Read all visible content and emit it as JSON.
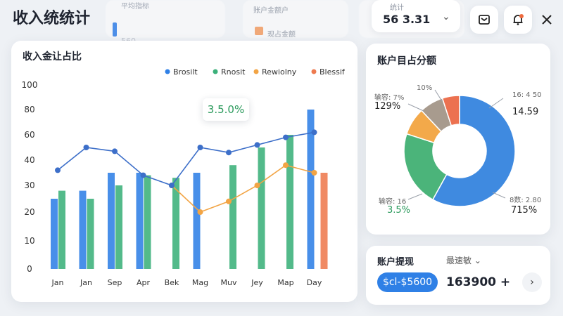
{
  "header": {
    "title": "收入统统计",
    "bg_items": [
      "平均指标",
      "账户金额户",
      "现占金额"
    ],
    "bg_value": "560",
    "period_label": "统计",
    "period_value": "56 3.31"
  },
  "icons": {
    "export": "export-icon",
    "alert": "bell-icon",
    "close": "close-icon"
  },
  "colors": {
    "blue": "#2f80e6",
    "green": "#3bb07a",
    "orange": "#f2a444",
    "red": "#ee7a4f",
    "accent": "#2f80e6"
  },
  "income_card": {
    "title": "收入金让占比",
    "legend": [
      "Brosilt",
      "Rnosit",
      "Rewiolny",
      "Blessif"
    ],
    "tooltip": "3.5.0%"
  },
  "chart_data": {
    "type": "bar",
    "title": "收入金让占比",
    "categories": [
      "Jan",
      "Jan",
      "Sep",
      "Apr",
      "Bek",
      "Mag",
      "Muv",
      "Jey",
      "Map",
      "Day"
    ],
    "yticks": [
      0,
      10,
      20,
      30,
      40,
      60,
      80,
      100
    ],
    "series": [
      {
        "name": "Brosilt",
        "kind": "bar",
        "values": [
          25,
          28,
          35,
          35,
          0,
          35,
          0,
          0,
          0,
          80
        ]
      },
      {
        "name": "Rnosit",
        "kind": "bar",
        "values": [
          28,
          25,
          30,
          34,
          33,
          0,
          38,
          50,
          60,
          0
        ]
      },
      {
        "name": "Rewiolny",
        "kind": "line",
        "values": [
          null,
          null,
          null,
          null,
          30,
          20,
          24,
          30,
          38,
          35
        ]
      },
      {
        "name": "Blessif",
        "kind": "bar",
        "values": [
          0,
          0,
          0,
          0,
          0,
          0,
          0,
          0,
          0,
          35
        ]
      },
      {
        "name": "Brosilt",
        "kind": "line",
        "values": [
          36,
          50,
          47,
          34,
          30,
          50,
          46,
          52,
          58,
          62
        ]
      }
    ],
    "grid": false,
    "legend_position": "top-right"
  },
  "distribution_card": {
    "title": "账户目占分额",
    "labels": [
      {
        "name": "输容: 7%",
        "value": "129%"
      },
      {
        "name": "",
        "value": "10%"
      },
      {
        "name": "16: 4 50",
        "value": "14.59"
      },
      {
        "name": "输容: 16",
        "value": "3.5%"
      },
      {
        "name": "8数: 2.80",
        "value": "715%"
      }
    ]
  },
  "donut_data": {
    "type": "pie",
    "slices": [
      {
        "name": "blue",
        "value": 58
      },
      {
        "name": "green",
        "value": 22
      },
      {
        "name": "orange",
        "value": 8
      },
      {
        "name": "gray",
        "value": 7
      },
      {
        "name": "red",
        "value": 5
      }
    ]
  },
  "withdraw_card": {
    "title": "账户提现",
    "filter": "最速敏",
    "pill": "$cl-$5600",
    "amount": "163900 +"
  }
}
